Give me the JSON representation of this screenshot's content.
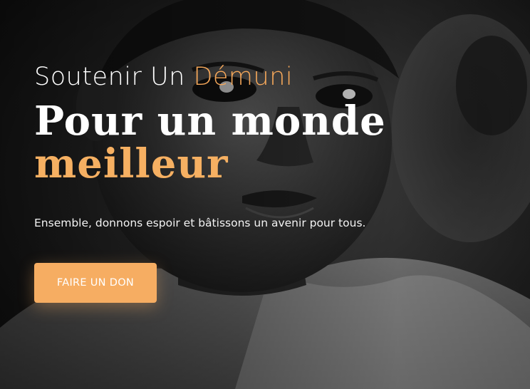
{
  "hero": {
    "eyebrow_prefix": "Soutenir Un",
    "eyebrow_accent": "Démuni",
    "headline_line1": "Pour un monde",
    "headline_line2": "meilleur",
    "subtitle": "Ensemble, donnons espoir et bâtissons un avenir pour tous.",
    "cta_label": "FAIRE UN DON",
    "background_image": "grayscale-portrait-child"
  },
  "colors": {
    "accent": "#f6a85a",
    "button_bg": "#f6ad62",
    "text": "#ffffff"
  }
}
